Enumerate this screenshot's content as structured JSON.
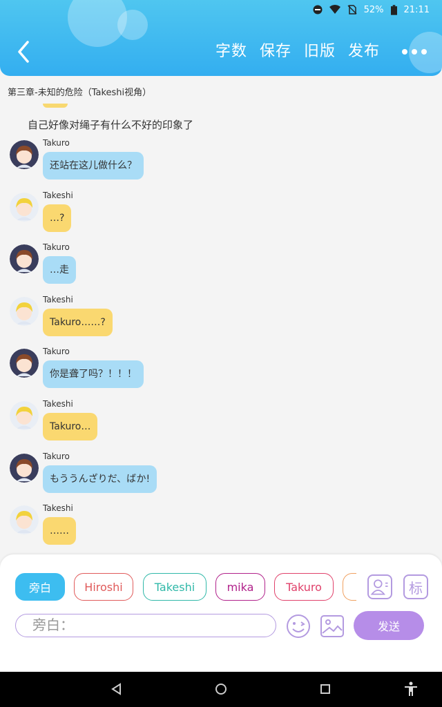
{
  "status": {
    "battery": "52%",
    "time": "21:11"
  },
  "header": {
    "actions": [
      "字数",
      "保存",
      "旧版",
      "发布"
    ]
  },
  "chapter": {
    "title": "第三章-未知的危险（Takeshi视角）"
  },
  "narration": "自己好像对绳子有什么不好的印象了",
  "messages": [
    {
      "speaker": "Takuro",
      "text": "还站在这儿做什么？",
      "color": "blue"
    },
    {
      "speaker": "Takeshi",
      "text": "…?",
      "color": "yellow"
    },
    {
      "speaker": "Takuro",
      "text": "…走",
      "color": "blue"
    },
    {
      "speaker": "Takeshi",
      "text": "Takuro……?",
      "color": "yellow"
    },
    {
      "speaker": "Takuro",
      "text": "你是聋了吗？！！！",
      "color": "blue"
    },
    {
      "speaker": "Takeshi",
      "text": "Takuro…",
      "color": "yellow"
    },
    {
      "speaker": "Takuro",
      "text": "もううんざりだ、ばか!",
      "color": "blue"
    },
    {
      "speaker": "Takeshi",
      "text": "……",
      "color": "yellow"
    }
  ],
  "role_chips": [
    {
      "label": "旁白",
      "color": "#3dbdf0",
      "active": true
    },
    {
      "label": "Hiroshi",
      "color": "#e05a5a",
      "active": false
    },
    {
      "label": "Takeshi",
      "color": "#2fb8a8",
      "active": false
    },
    {
      "label": "mika",
      "color": "#b0208a",
      "active": false
    },
    {
      "label": "Takuro",
      "color": "#e0406a",
      "active": false
    }
  ],
  "tools": {
    "mark_label": "标"
  },
  "input": {
    "placeholder": "旁白："
  },
  "send_label": "发送",
  "colors": {
    "header": "#33aef0",
    "accent": "#b68de8",
    "blue_bubble": "#a9dcf6",
    "yellow_bubble": "#fad870"
  }
}
